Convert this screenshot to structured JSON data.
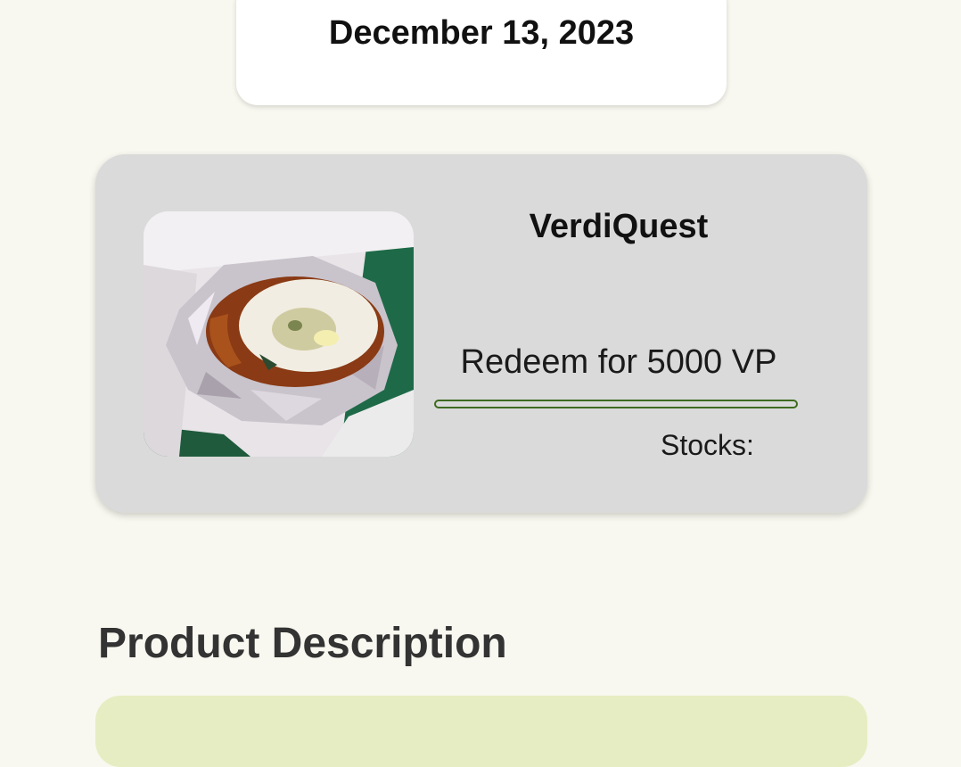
{
  "date_card": {
    "date": "December 13, 2023"
  },
  "product": {
    "name": "VerdiQuest",
    "redeem_label": "Redeem for 5000 VP",
    "stocks_label": "Stocks:",
    "image_icon": "food-photo-icon"
  },
  "description": {
    "title": "Product Description"
  },
  "colors": {
    "background": "#f8f8f0",
    "card": "#dadada",
    "accent_green": "#3d6b1f",
    "description_bg": "#e7edc3"
  }
}
